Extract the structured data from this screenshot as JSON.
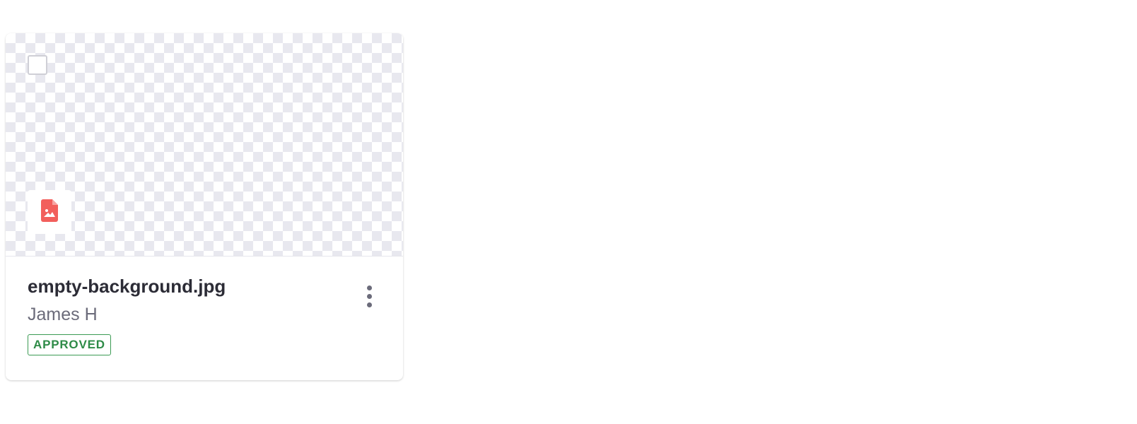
{
  "card": {
    "file_name": "empty-background.jpg",
    "author": "James H",
    "status": "APPROVED",
    "file_type_icon": "image-file-icon",
    "more_icon": "more-vertical-icon",
    "colors": {
      "status": "#2e8b47",
      "file_icon": "#f25f5c"
    }
  }
}
